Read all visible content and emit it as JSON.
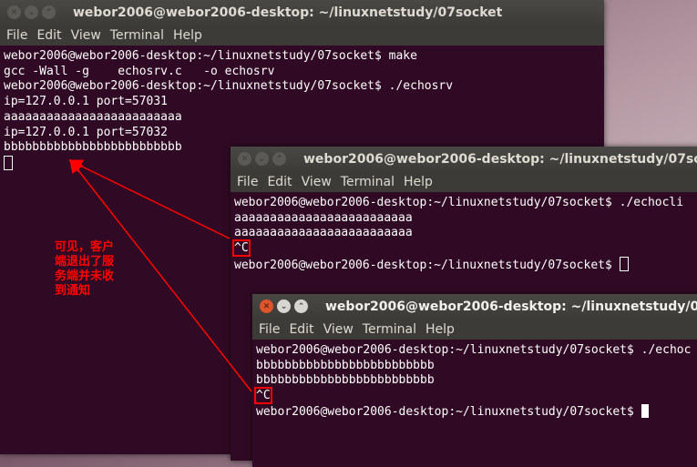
{
  "win1": {
    "title": "webor2006@webor2006-desktop: ~/linuxnetstudy/07socket",
    "menu": [
      "File",
      "Edit",
      "View",
      "Terminal",
      "Help"
    ],
    "lines": [
      "webor2006@webor2006-desktop:~/linuxnetstudy/07socket$ make",
      "gcc -Wall -g    echosrv.c   -o echosrv",
      "webor2006@webor2006-desktop:~/linuxnetstudy/07socket$ ./echosrv",
      "ip=127.0.0.1 port=57031",
      "aaaaaaaaaaaaaaaaaaaaaaaaa",
      "ip=127.0.0.1 port=57032",
      "bbbbbbbbbbbbbbbbbbbbbbbbb"
    ]
  },
  "win2": {
    "title": "webor2006@webor2006-desktop: ~/linuxnetstudy/07sock",
    "menu": [
      "File",
      "Edit",
      "View",
      "Terminal",
      "Help"
    ],
    "lines": [
      "webor2006@webor2006-desktop:~/linuxnetstudy/07socket$ ./echocli",
      "aaaaaaaaaaaaaaaaaaaaaaaaa",
      "aaaaaaaaaaaaaaaaaaaaaaaaa"
    ],
    "ctrl_c": "^C",
    "prompt": "webor2006@webor2006-desktop:~/linuxnetstudy/07socket$ "
  },
  "win3": {
    "title": "webor2006@webor2006-desktop: ~/linuxnetstudy/07s",
    "menu": [
      "File",
      "Edit",
      "View",
      "Terminal",
      "Help"
    ],
    "lines": [
      "webor2006@webor2006-desktop:~/linuxnetstudy/07socket$ ./echoc",
      "bbbbbbbbbbbbbbbbbbbbbbbbb",
      "bbbbbbbbbbbbbbbbbbbbbbbbb"
    ],
    "ctrl_c": "^C",
    "prompt": "webor2006@webor2006-desktop:~/linuxnetstudy/07socket$ "
  },
  "annotation": {
    "text": "可见，客户\n端退出了服\n务端并未收\n到通知",
    "color": "#ff0000"
  }
}
